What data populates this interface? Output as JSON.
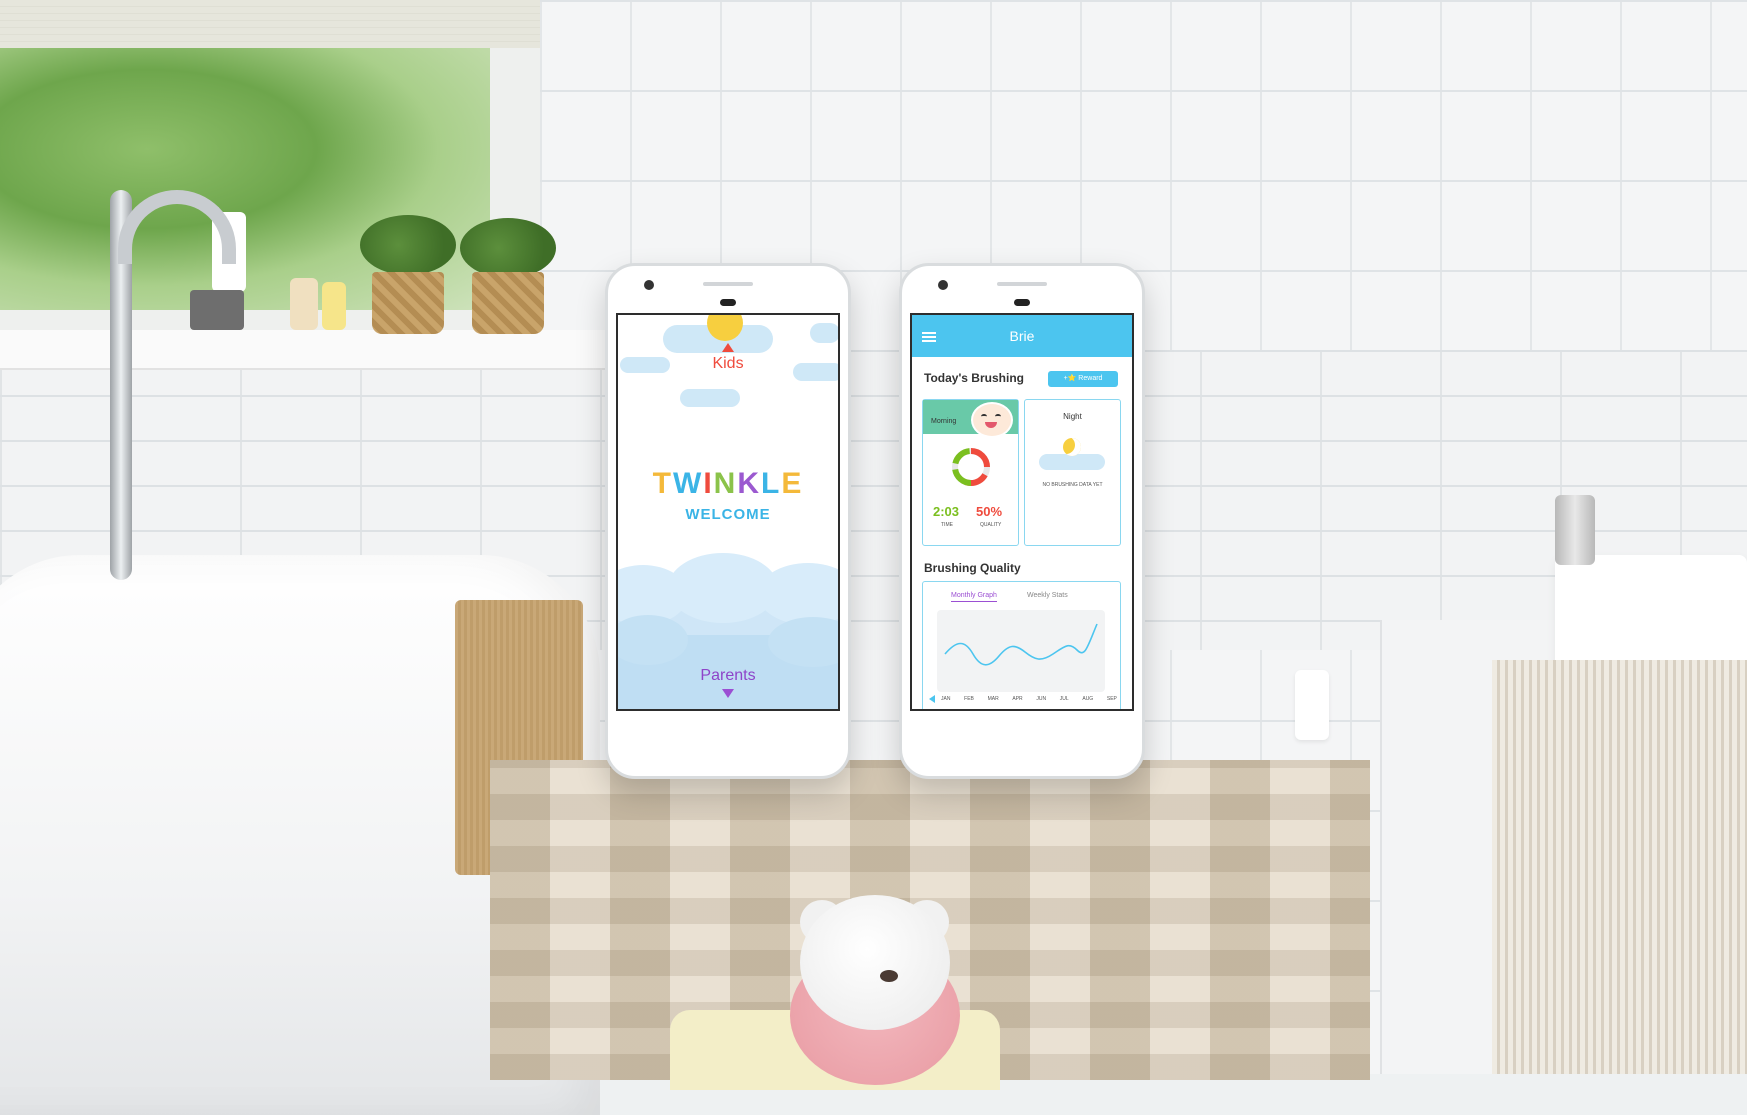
{
  "colors": {
    "accent": "#4cc5ef",
    "kids_red": "#ef4b3d",
    "parents_purple": "#8e44c9",
    "time_green": "#7bbf1f",
    "quality_red": "#ef4b3d",
    "morning_green": "#69c9a8"
  },
  "phone1": {
    "kids_label": "Kids",
    "title_letters": [
      {
        "ch": "T",
        "color": "#f4b93a"
      },
      {
        "ch": "W",
        "color": "#3bb4e6"
      },
      {
        "ch": "I",
        "color": "#ef4b3d"
      },
      {
        "ch": "N",
        "color": "#8bc34a"
      },
      {
        "ch": "K",
        "color": "#9b59d0"
      },
      {
        "ch": "L",
        "color": "#3bb4e6"
      },
      {
        "ch": "E",
        "color": "#f4b93a"
      }
    ],
    "welcome": "WELCOME",
    "parents_label": "Parents",
    "icons": [
      "sun-icon",
      "cloud-icon",
      "up-arrow-icon",
      "down-arrow-icon"
    ]
  },
  "phone2": {
    "app_title": "Brie",
    "menu_icon": "hamburger-icon",
    "section_today": "Today's Brushing",
    "reward_label": "+⭐ Reward",
    "morning": {
      "label": "Morning",
      "time_value": "2:03",
      "time_caption": "TIME",
      "quality_value": "50%",
      "quality_caption": "QUALITY",
      "progress": 0.5
    },
    "night": {
      "label": "Night",
      "empty_text": "NO BRUSHING DATA YET",
      "icon": "moon-cloud-icon"
    },
    "section_quality": "Brushing Quality",
    "tabs": [
      "Monthly Graph",
      "Weekly Stats"
    ],
    "active_tab": "Monthly Graph",
    "months": [
      "JAN",
      "FEB",
      "MAR",
      "APR",
      "JUN",
      "JUL",
      "AUG",
      "SEP"
    ]
  }
}
